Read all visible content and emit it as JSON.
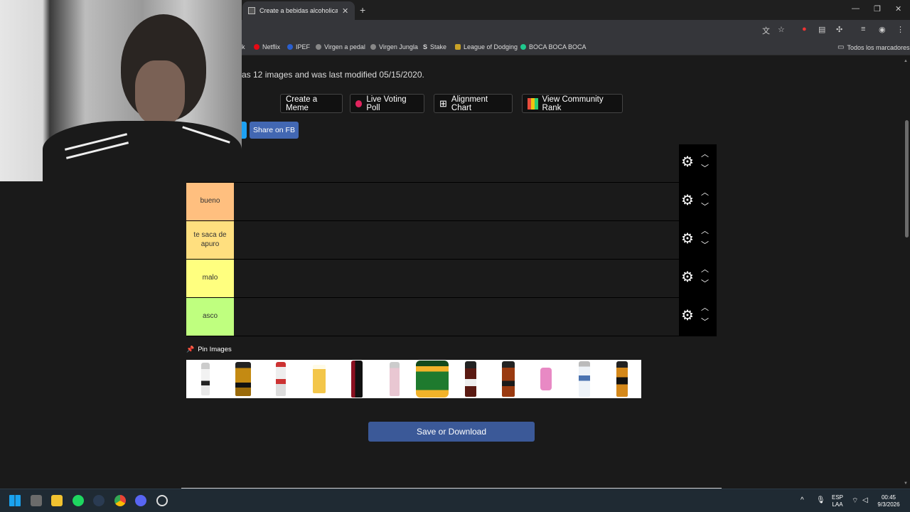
{
  "browser": {
    "tab_title": "Create a bebidas alcoholicas Ti",
    "new_tab": "+",
    "bookmarks": [
      "Netflix",
      "IPEF",
      "Virgen a pedal",
      "Virgen Jungla",
      "Stake",
      "League of Dodging",
      "BOCA BOCA BOCA"
    ],
    "bookmarks_folder": "Todos los marcadores",
    "bookmark_partial": "k"
  },
  "page": {
    "info_text": "as 12 images and was last modified 05/15/2020.",
    "buttons": {
      "create_meme": "Create a Meme",
      "live_voting": "Live Voting Poll",
      "alignment_chart": "Alignment Chart",
      "community_rank": "View Community Rank",
      "share_fb": "Share on FB"
    },
    "tiers": [
      {
        "label": "",
        "color": "#1a1a1a"
      },
      {
        "label": "bueno",
        "color": "#ffbf7f"
      },
      {
        "label": "te saca de apuro",
        "color": "#ffdf7f"
      },
      {
        "label": "malo",
        "color": "#ffff7f"
      },
      {
        "label": "asco",
        "color": "#bfff7f"
      }
    ],
    "pin_images": "Pin Images",
    "save_button": "Save or Download",
    "image_count": 12
  },
  "taskbar": {
    "lang_top": "ESP",
    "lang_bottom": "LAA",
    "time": "00:45",
    "date": "9/3/2026"
  },
  "colors": {
    "fb_blue": "#4267b2",
    "save_blue": "#3b5998",
    "control_bg": "#000000"
  }
}
